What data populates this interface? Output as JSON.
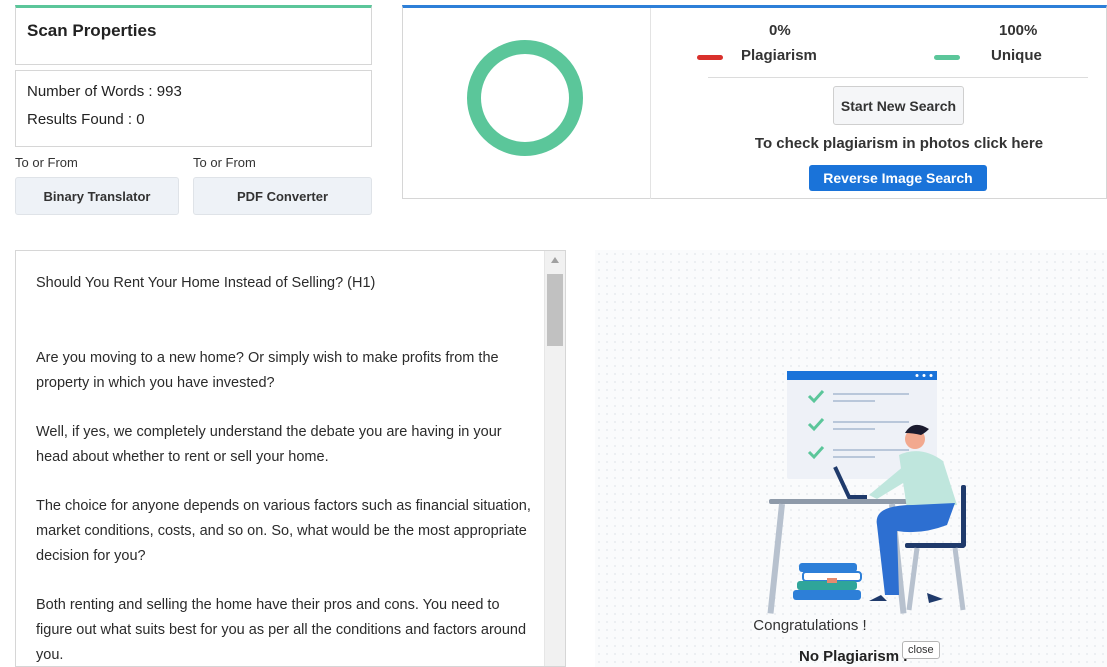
{
  "scan_properties": {
    "title": "Scan Properties",
    "words_label": "Number of Words : 993",
    "results_label": "Results Found : 0"
  },
  "tools": [
    {
      "label": "To or From",
      "button": "Binary Translator"
    },
    {
      "label": "To or From",
      "button": "PDF Converter"
    }
  ],
  "result": {
    "plagiarism_percent": "0%",
    "unique_percent": "100%",
    "plagiarism_label": "Plagiarism",
    "unique_label": "Unique",
    "plagiarism_value": 0,
    "unique_value": 100,
    "start_new_button": "Start New Search",
    "photo_hint": "To check plagiarism in photos click here",
    "reverse_button": "Reverse Image Search"
  },
  "colors": {
    "plagiarism": "#d9302c",
    "unique": "#5bc69a",
    "accent_blue": "#1a73d9"
  },
  "document": {
    "heading": "Should You Rent Your Home Instead of Selling? (H1)",
    "paragraphs": [
      "Are you moving to a new home? Or simply wish to make profits from the property in which you have invested?",
      "Well, if yes, we completely understand the debate you are having in your head about whether to rent or sell your home.",
      "The choice for anyone depends on various factors such as financial situation, market conditions, costs, and so on. So, what would be the most appropriate decision for you?",
      "Both renting and selling the home have their pros and cons. You need to figure out what suits best for you as per all the conditions and factors around you."
    ]
  },
  "illustration": {
    "congrats": "Congratulations !",
    "no_plagiarism": "No Plagiarism F",
    "close_tooltip": "close"
  }
}
